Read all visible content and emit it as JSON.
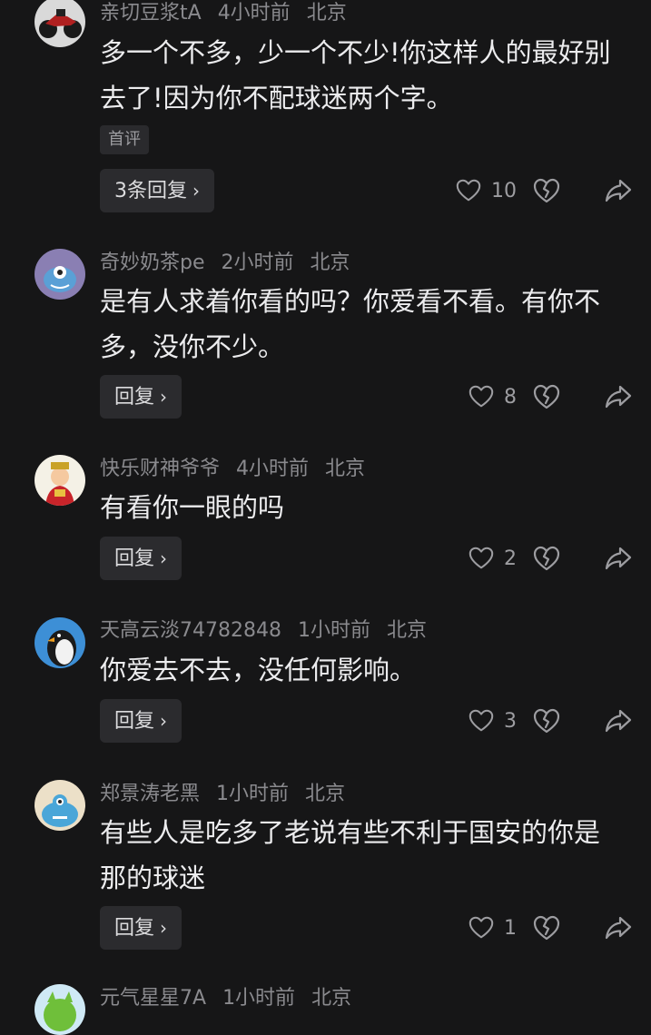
{
  "comments": [
    {
      "username": "亲切豆浆tA",
      "time": "4小时前",
      "location": "北京",
      "text": "多一个不多，少一个不少!你这样人的最好别去了!因为你不配球迷两个字。",
      "tag": "首评",
      "reply_label": "3条回复",
      "likes": "10",
      "avatar_icon": "motorcycle-avatar"
    },
    {
      "username": "奇妙奶茶pe",
      "time": "2小时前",
      "location": "北京",
      "text": "是有人求着你看的吗？你爱看不看。有你不多，没你不少。",
      "reply_label": "回复",
      "likes": "8",
      "avatar_icon": "cartoon-monster-avatar"
    },
    {
      "username": "快乐财神爷爷",
      "time": "4小时前",
      "location": "北京",
      "text": "有看你一眼的吗",
      "reply_label": "回复",
      "likes": "2",
      "avatar_icon": "god-of-wealth-avatar"
    },
    {
      "username": "天高云淡74782848",
      "time": "1小时前",
      "location": "北京",
      "text": "你爱去不去，没任何影响。",
      "reply_label": "回复",
      "likes": "3",
      "avatar_icon": "penguin-avatar"
    },
    {
      "username": "郑景涛老黑",
      "time": "1小时前",
      "location": "北京",
      "text": "有些人是吃多了老说有些不利于国安的你是那的球迷",
      "reply_label": "回复",
      "likes": "1",
      "avatar_icon": "blue-monster-avatar"
    },
    {
      "username": "元气星星7A",
      "time": "1小时前",
      "location": "北京",
      "avatar_icon": "green-creature-avatar"
    }
  ],
  "icons": {
    "like": "heart-icon",
    "dislike": "broken-heart-icon",
    "share": "share-arrow-icon",
    "chevron": "›"
  },
  "colors": {
    "background": "#161617",
    "button_bg": "#2b2b2e",
    "meta_text": "#8a8a8e"
  }
}
